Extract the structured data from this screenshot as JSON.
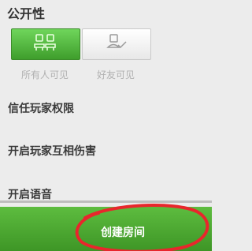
{
  "privacy": {
    "title": "公开性",
    "options": [
      {
        "label": "所有人可见",
        "icon": "group-icon",
        "selected": true
      },
      {
        "label": "好友可见",
        "icon": "friend-icon",
        "selected": false
      }
    ]
  },
  "settings": {
    "trust_permissions": "信任玩家权限",
    "pvp": "开启玩家互相伤害",
    "voice": "开启语音"
  },
  "footer": {
    "create_room_label": "创建房间"
  },
  "colors": {
    "accent_green": "#4caf36",
    "annotation_red": "#e8262c"
  }
}
